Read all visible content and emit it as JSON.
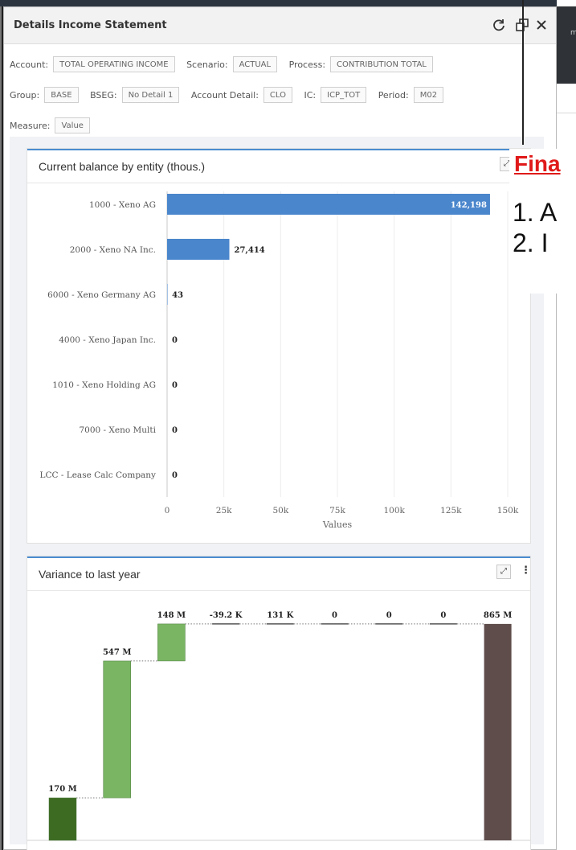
{
  "background": {
    "toolbar_text": "ma"
  },
  "dialog": {
    "title": "Details Income Statement",
    "icons": [
      "refresh-icon",
      "popout-icon",
      "close-icon"
    ]
  },
  "filters": {
    "row1": [
      {
        "label": "Account:",
        "value": "TOTAL OPERATING INCOME"
      },
      {
        "label": "Scenario:",
        "value": "ACTUAL"
      },
      {
        "label": "Process:",
        "value": "CONTRIBUTION TOTAL"
      }
    ],
    "row2": [
      {
        "label": "Group:",
        "value": "BASE"
      },
      {
        "label": "BSEG:",
        "value": "No Detail 1"
      },
      {
        "label": "Account Detail:",
        "value": "CLO"
      },
      {
        "label": "IC:",
        "value": "ICP_TOT"
      },
      {
        "label": "Period:",
        "value": "M02"
      }
    ],
    "row3": [
      {
        "label": "Measure:",
        "value": "Value"
      }
    ]
  },
  "chart1": {
    "title": "Current balance by entity (thous.)"
  },
  "chart2": {
    "title": "Variance to last year"
  },
  "annotation": {
    "title": "Fina",
    "items": [
      "1.  A",
      "2.  I"
    ]
  },
  "colors": {
    "bar_blue": "#4a86cc",
    "wf_dark_green": "#3d6b22",
    "wf_green": "#79b563",
    "wf_total": "#5e4d4b",
    "panel_border": "#4a8cd0",
    "annotation_red": "#e01a1a"
  },
  "chart_data": [
    {
      "type": "bar",
      "orientation": "horizontal",
      "title": "Current balance by entity (thous.)",
      "categories": [
        "1000 - Xeno AG",
        "2000 - Xeno NA Inc.",
        "6000 - Xeno Germany AG",
        "4000 - Xeno Japan Inc.",
        "1010 - Xeno Holding AG",
        "7000 - Xeno Multi",
        "LCC - Lease Calc Company"
      ],
      "values": [
        142198,
        27414,
        43,
        0,
        0,
        0,
        0
      ],
      "value_labels": [
        "142,198",
        "27,414",
        "43",
        "0",
        "0",
        "0",
        "0"
      ],
      "xlabel": "Values",
      "xlim": [
        0,
        150000
      ],
      "x_ticks": [
        0,
        25000,
        50000,
        75000,
        100000,
        125000,
        150000
      ],
      "x_tick_labels": [
        "0",
        "25k",
        "50k",
        "75k",
        "100k",
        "125k",
        "150k"
      ],
      "grid": true
    },
    {
      "type": "bar",
      "variant": "waterfall",
      "title": "Variance to last year",
      "value_labels": [
        "170 M",
        "547 M",
        "148 M",
        "-39.2 K",
        "131 K",
        "0",
        "0",
        "0",
        "865 M"
      ],
      "values": [
        170,
        547,
        148,
        -0.0392,
        0.131,
        0,
        0,
        0,
        865
      ],
      "units": "M",
      "ylim": [
        0,
        900
      ],
      "bar_kinds": [
        "start",
        "increase",
        "increase",
        "flat",
        "flat",
        "flat",
        "flat",
        "flat",
        "total"
      ]
    }
  ]
}
